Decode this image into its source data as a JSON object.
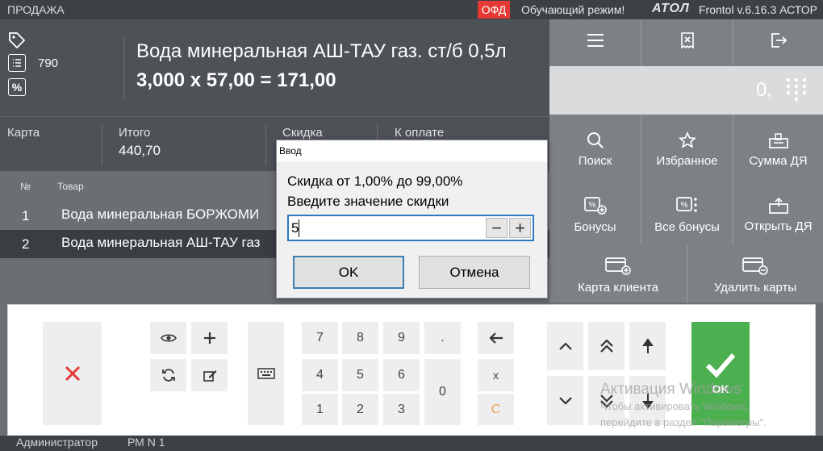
{
  "topbar": {
    "mode": "ПРОДАЖА",
    "ofd_badge": "ОФД",
    "training_mode": "Обучающий режим!",
    "brand": "АТОЛ",
    "version": "Frontol v.6.16.3 АСТОР"
  },
  "item": {
    "code": "790",
    "name": "Вода минеральная АШ-ТАУ газ. ст/б 0,5л",
    "calc": "3,000 x 57,00 = 171,00"
  },
  "totals": {
    "card_label": "Карта",
    "total_label": "Итого",
    "total_value": "440,70",
    "discount_label": "Скидка",
    "pay_label": "К оплате"
  },
  "receipt": {
    "col_num": "№",
    "col_item": "Товар",
    "rows": [
      {
        "num": "1",
        "name": "Вода минеральная БОРЖОМИ"
      },
      {
        "num": "2",
        "name": "Вода минеральная АШ-ТАУ газ"
      }
    ]
  },
  "quantity": "0,",
  "functions": {
    "search": "Поиск",
    "favorites": "Избранное",
    "sum_dya": "Сумма ДЯ",
    "bonuses": "Бонусы",
    "all_bonuses": "Все бонусы",
    "open_dya": "Открыть ДЯ",
    "client_card": "Карта клиента",
    "delete_cards": "Удалить карты"
  },
  "keypad": {
    "digits": [
      "7",
      "8",
      "9",
      "4",
      "5",
      "6",
      "1",
      "2",
      "3",
      "0"
    ],
    "dot": ".",
    "mult": "x",
    "clear": "C",
    "ok": "OK"
  },
  "dialog": {
    "title": "Ввод",
    "line1": "Скидка от 1,00% до 99,00%",
    "line2": "Введите значение скидки",
    "value": "5",
    "minus": "−",
    "plus": "+",
    "ok": "OK",
    "cancel": "Отмена"
  },
  "watermark": {
    "title": "Активация Windows",
    "line1": "Чтобы активировать Windows,",
    "line2": "перейдите в раздел \"Параметры\"."
  },
  "status": {
    "user": "Администратор",
    "terminal": "РМ N 1"
  },
  "colors": {
    "ofd": "#e53935",
    "ok_green": "#4caf50",
    "cancel_red": "#e53935",
    "clear_orange": "#f0a050"
  }
}
